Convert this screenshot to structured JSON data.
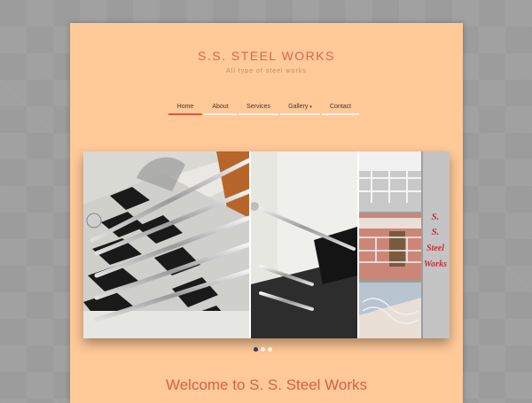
{
  "header": {
    "title": "S.S. STEEL WORKS",
    "tagline": "All type of steel works"
  },
  "nav": {
    "items": [
      {
        "label": "Home",
        "active": true
      },
      {
        "label": "About"
      },
      {
        "label": "Services"
      },
      {
        "label": "Gallery",
        "dropdown": true
      },
      {
        "label": "Contact"
      }
    ],
    "dropdown_caret": "▾"
  },
  "slider": {
    "overlay_text": [
      "S.",
      "S.",
      "Steel",
      "Works"
    ],
    "slide_count": 3,
    "current_slide": 1
  },
  "main": {
    "welcome": "Welcome to S. S. Steel Works"
  },
  "colors": {
    "page_bg": "#ffc998",
    "accent": "#e2593f",
    "title": "#d9664f"
  }
}
